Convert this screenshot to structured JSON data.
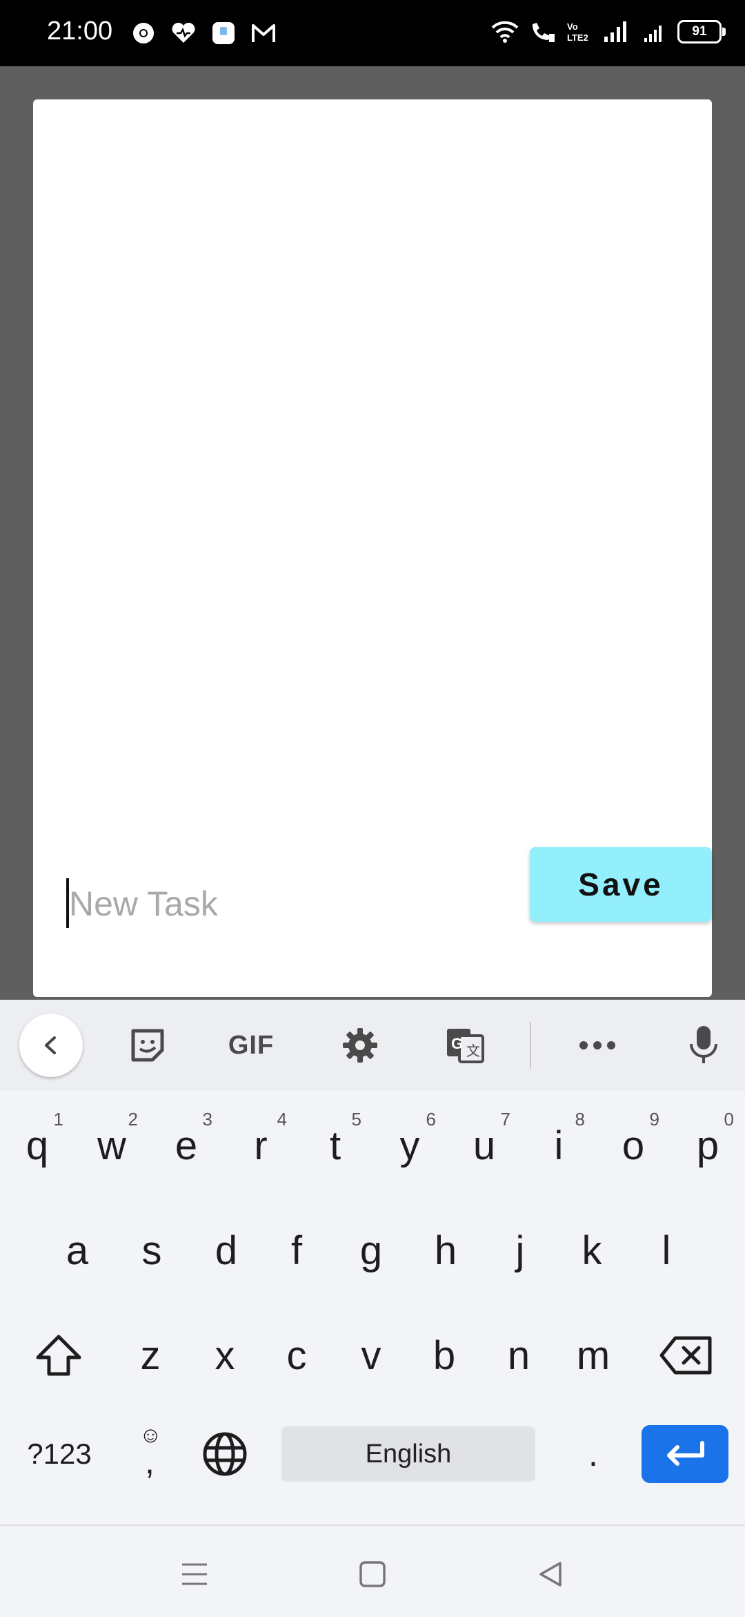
{
  "status_bar": {
    "time": "21:00",
    "battery": "91",
    "left_icons": [
      "chrome-icon",
      "health-icon",
      "app-icon",
      "gmail-icon"
    ],
    "right_icons": [
      "wifi-icon",
      "wifi-calling-icon",
      "volte-icon",
      "signal-icon",
      "signal-icon-2",
      "battery-icon"
    ]
  },
  "dialog": {
    "input_placeholder": "New Task",
    "input_value": "",
    "save_label": "Save",
    "save_color": "#93effc"
  },
  "keyboard": {
    "toolbar": {
      "gif_label": "GIF",
      "icons": [
        "back-chevron-icon",
        "sticker-icon",
        "gif-icon",
        "settings-gear-icon",
        "translate-icon",
        "more-dots-icon",
        "microphone-icon"
      ]
    },
    "row1": [
      {
        "key": "q",
        "hint": "1"
      },
      {
        "key": "w",
        "hint": "2"
      },
      {
        "key": "e",
        "hint": "3"
      },
      {
        "key": "r",
        "hint": "4"
      },
      {
        "key": "t",
        "hint": "5"
      },
      {
        "key": "y",
        "hint": "6"
      },
      {
        "key": "u",
        "hint": "7"
      },
      {
        "key": "i",
        "hint": "8"
      },
      {
        "key": "o",
        "hint": "9"
      },
      {
        "key": "p",
        "hint": "0"
      }
    ],
    "row2": [
      "a",
      "s",
      "d",
      "f",
      "g",
      "h",
      "j",
      "k",
      "l"
    ],
    "row3": [
      "z",
      "x",
      "c",
      "v",
      "b",
      "n",
      "m"
    ],
    "row4": {
      "symbols_label": "?123",
      "comma_label": ",",
      "space_label": "English",
      "period_label": ".",
      "enter_color": "#1a73e8"
    }
  }
}
